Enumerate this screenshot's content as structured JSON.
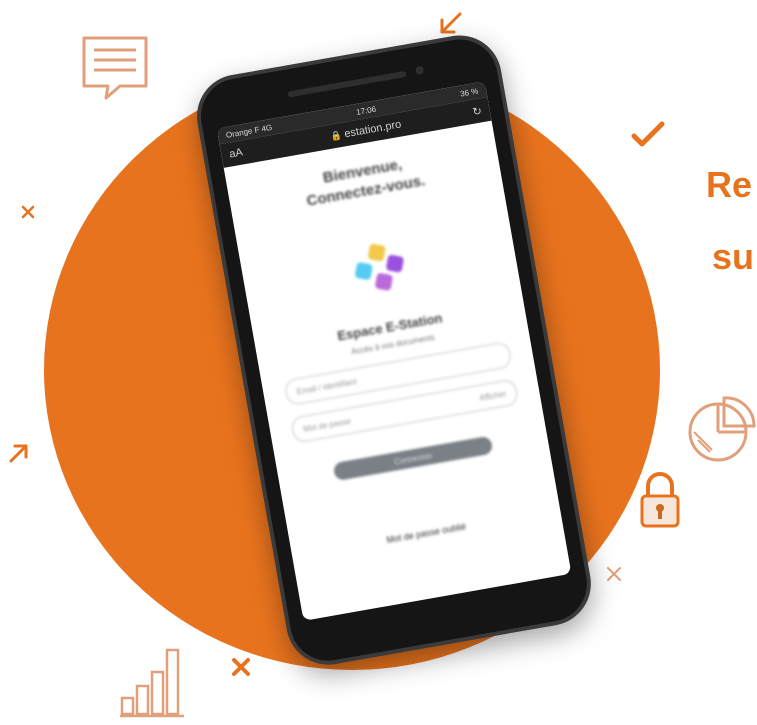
{
  "headline": {
    "line1": "Re",
    "line2": "su"
  },
  "phone": {
    "status": {
      "carrier": "Orange F 4G",
      "time": "17:06",
      "battery": "36 %"
    },
    "browser": {
      "text_size": "aA",
      "url": "estation.pro"
    },
    "login": {
      "greeting_line1": "Bienvenue,",
      "greeting_line2": "Connectez-vous.",
      "brand": "Espace E-Station",
      "subtitle": "Accès à vos documents",
      "email_placeholder": "Email / identifiant",
      "password_placeholder": "Mot de passe",
      "show_label": "Afficher",
      "submit_label": "Connexion",
      "footer_link": "Mot de passe oublié"
    }
  },
  "colors": {
    "accent": "#E8731E",
    "decoration": "#E0A07A"
  },
  "icons": [
    "chat-icon",
    "arrow-down-left-icon",
    "check-icon",
    "pie-chart-icon",
    "padlock-icon",
    "bar-chart-icon",
    "arrow-up-right-icon",
    "cross-icon"
  ]
}
